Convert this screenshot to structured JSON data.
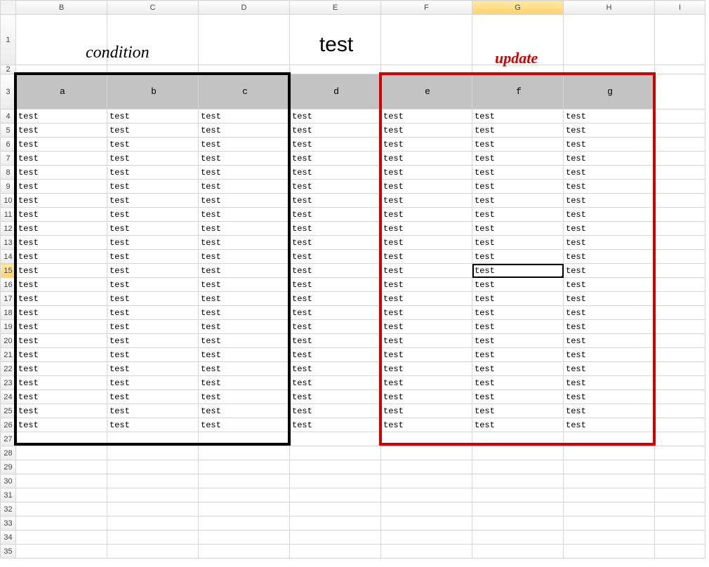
{
  "columns": [
    "B",
    "C",
    "D",
    "E",
    "F",
    "G",
    "H",
    "I"
  ],
  "rows": [
    "1",
    "2",
    "3",
    "4",
    "5",
    "6",
    "7",
    "8",
    "9",
    "10",
    "11",
    "12",
    "13",
    "14",
    "15",
    "16",
    "17",
    "18",
    "19",
    "20",
    "21",
    "22",
    "23",
    "24",
    "25",
    "26",
    "27",
    "28",
    "29",
    "30",
    "31",
    "32",
    "33",
    "34",
    "35"
  ],
  "selected_col": "G",
  "selected_row": "15",
  "title": "test",
  "labels": {
    "condition": "condition",
    "update": "update"
  },
  "header_row": {
    "B": "a",
    "C": "b",
    "D": "c",
    "E": "d",
    "F": "e",
    "G": "f",
    "H": "g"
  },
  "data_value": "test",
  "data_first_row": 4,
  "data_last_row": 26,
  "data_cols": [
    "B",
    "C",
    "D",
    "E",
    "F",
    "G",
    "H"
  ],
  "condition_box_cols": [
    "B",
    "C",
    "D"
  ],
  "update_box_cols": [
    "F",
    "G",
    "H"
  ],
  "colors": {
    "header_fill": "#c3c3c3",
    "condition_border": "#000000",
    "update_border": "#d20000"
  }
}
